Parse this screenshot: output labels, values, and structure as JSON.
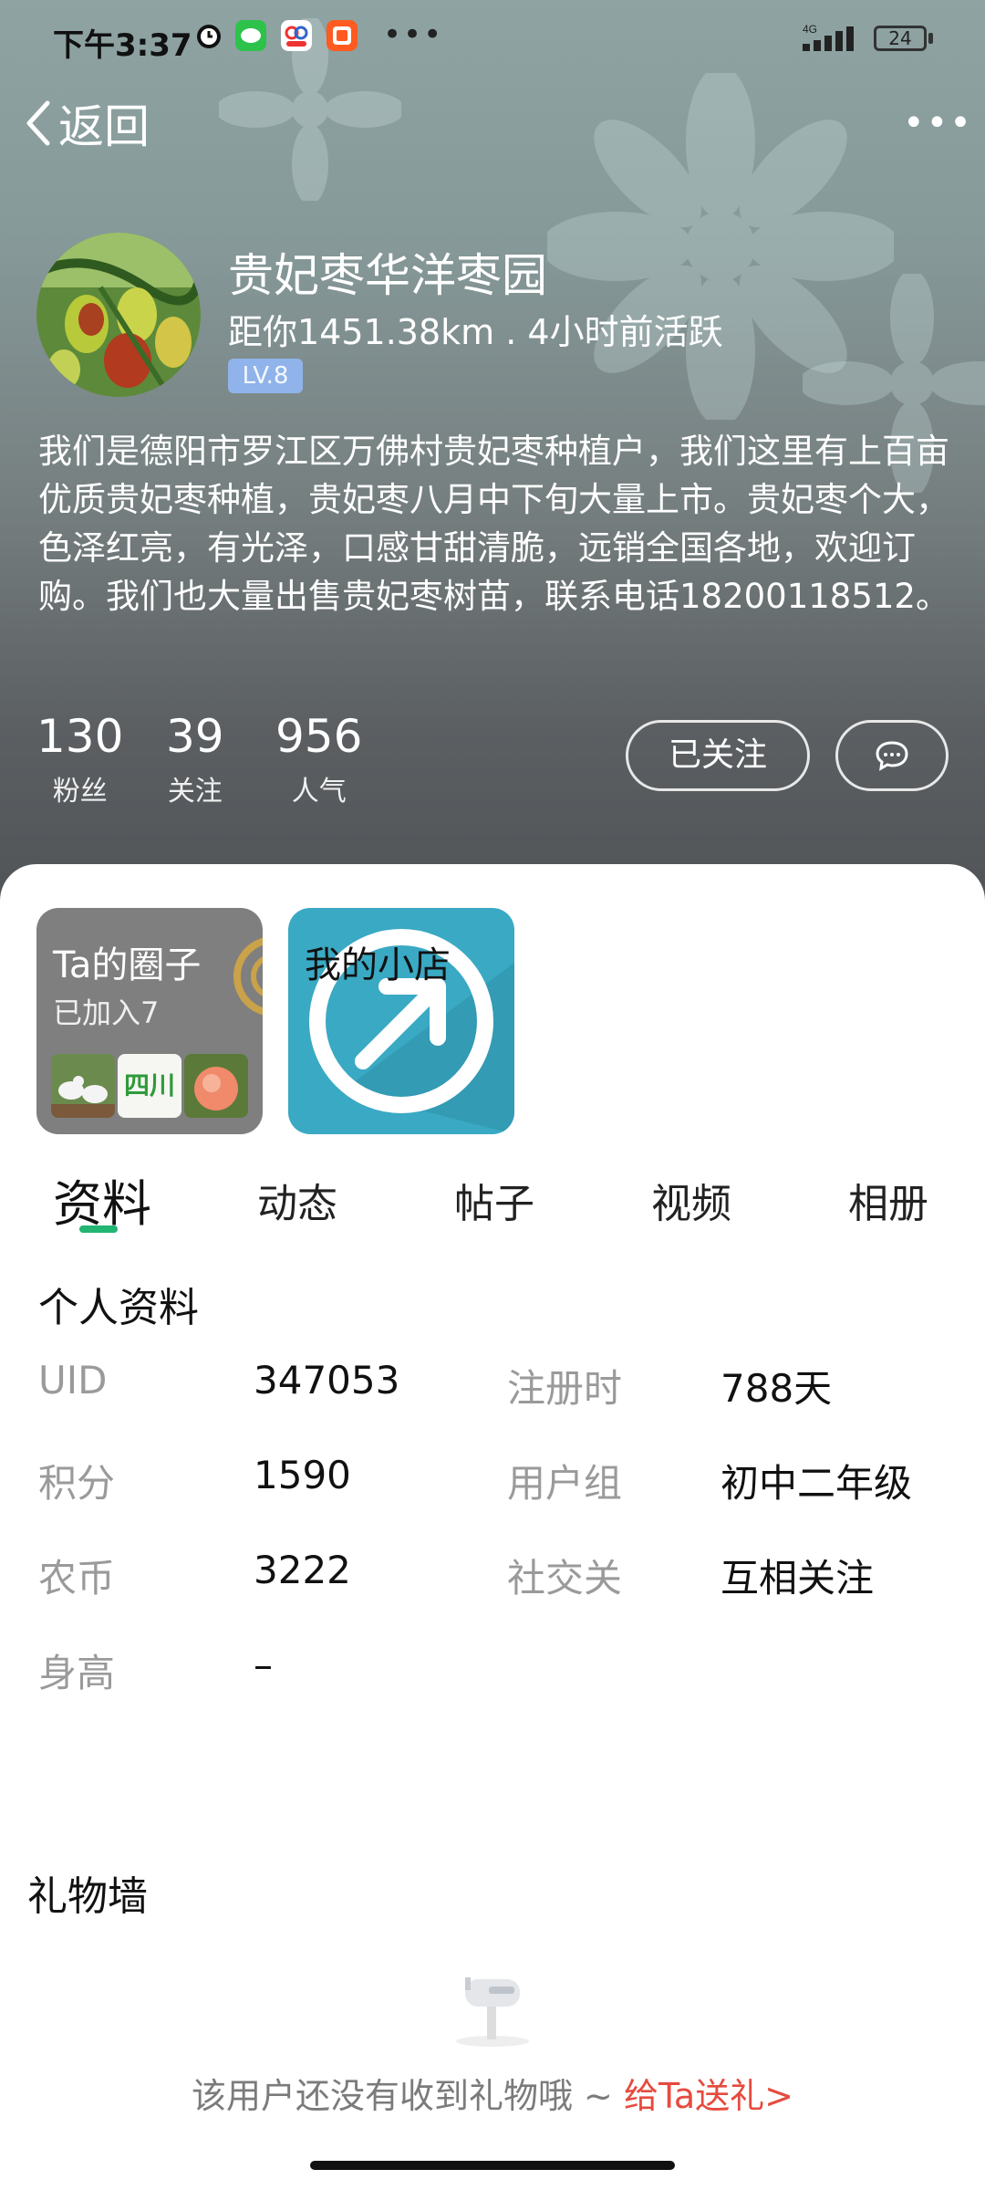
{
  "status_bar": {
    "time": "下午3:37",
    "network": "4G",
    "battery": "24",
    "app_icons": [
      "alarm-icon",
      "wechat-icon",
      "jingdong-icon",
      "taobao-icon"
    ]
  },
  "nav": {
    "back_label": "返回",
    "more_icon": "more-dots-icon"
  },
  "profile": {
    "name": "贵妃枣华洋枣园",
    "meta": "距你1451.38km . 4小时前活跃",
    "level": "LV.8",
    "bio": "我们是德阳市罗江区万佛村贵妃枣种植户，我们这里有上百亩优质贵妃枣种植，贵妃枣八月中下旬大量上市。贵妃枣个大，色泽红亮，有光泽，口感甘甜清脆，远销全国各地，欢迎订购。我们也大量出售贵妃枣树苗，联系电话18200118512。",
    "stats": [
      {
        "value": "130",
        "label": "粉丝"
      },
      {
        "value": "39",
        "label": "关注"
      },
      {
        "value": "956",
        "label": "人气"
      }
    ],
    "follow_label": "已关注"
  },
  "cards": {
    "circle": {
      "title": "Ta的圈子",
      "subtitle": "已加入7",
      "thumb_text": "四川"
    },
    "shop": {
      "title": "我的小店"
    }
  },
  "tabs": [
    "资料",
    "动态",
    "帖子",
    "视频",
    "相册"
  ],
  "personal_info": {
    "title": "个人资料",
    "rows": [
      {
        "label": "UID",
        "value": "347053"
      },
      {
        "label": "注册时",
        "value": "788天"
      },
      {
        "label": "积分",
        "value": "1590"
      },
      {
        "label": "用户组",
        "value": "初中二年级"
      },
      {
        "label": "农币",
        "value": "3222"
      },
      {
        "label": "社交关",
        "value": "互相关注"
      },
      {
        "label": "身高",
        "value": "–"
      }
    ]
  },
  "gift_wall": {
    "title": "礼物墙",
    "empty_text": "该用户还没有收到礼物哦 ~ ",
    "send_link": "给Ta送礼>"
  },
  "colors": {
    "accent_green": "#22b573",
    "link_red": "#e64a3e",
    "level_badge": "#8fb3ea"
  }
}
